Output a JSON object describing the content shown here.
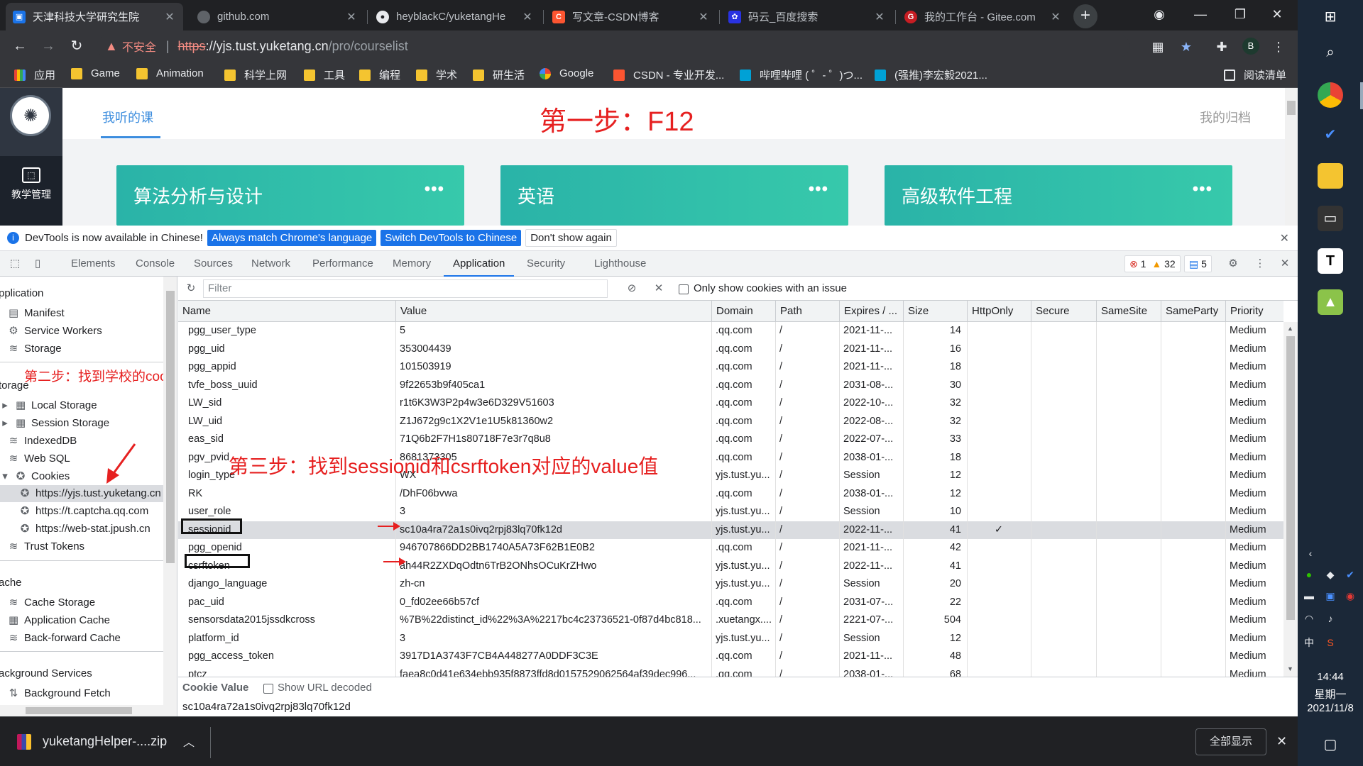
{
  "tabs": [
    {
      "title": "天津科技大学研究生院",
      "active": true
    },
    {
      "title": "github.com"
    },
    {
      "title": "heyblackC/yuketangHe"
    },
    {
      "title": "写文章-CSDN博客"
    },
    {
      "title": "码云_百度搜索"
    },
    {
      "title": "我的工作台 - Gitee.com"
    }
  ],
  "address": {
    "warning": "不安全",
    "scheme": "https",
    "host": "://yjs.tust.yuketang.cn",
    "path": "/pro/courselist"
  },
  "profile_initial": "B",
  "bookmarks": [
    "应用",
    "Game",
    "Animation",
    "科学上网",
    "工具",
    "编程",
    "学术",
    "研生活",
    "Google",
    "CSDN - 专业开发...",
    "哔哩哔哩 ( ゜- ゜)つ...",
    "(强推)李宏毅2021..."
  ],
  "reading_list": "阅读清单",
  "page": {
    "nav_label": "教学管理",
    "tab_label": "我听的课",
    "archive_label": "我的归档",
    "annotation_step1": "第一步：F12",
    "courses": [
      "算法分析与设计",
      "英语",
      "高级软件工程"
    ],
    "more_glyph": "•••"
  },
  "devtools_notice": {
    "text": "DevTools is now available in Chinese!",
    "btn1": "Always match Chrome's language",
    "btn2": "Switch DevTools to Chinese",
    "btn3": "Don't show again"
  },
  "devtools_tabs": [
    "Elements",
    "Console",
    "Sources",
    "Network",
    "Performance",
    "Memory",
    "Application",
    "Security",
    "Lighthouse"
  ],
  "issue_counts": {
    "errors": "1",
    "warnings": "32",
    "messages": "5"
  },
  "sidebar": {
    "section_application": "pplication",
    "manifest": "Manifest",
    "service_workers": "Service Workers",
    "storage_item": "Storage",
    "section_storage": "torage",
    "local_storage": "Local Storage",
    "session_storage": "Session Storage",
    "indexeddb": "IndexedDB",
    "web_sql": "Web SQL",
    "cookies": "Cookies",
    "cookie_origins": [
      "https://yjs.tust.yuketang.cn",
      "https://t.captcha.qq.com",
      "https://web-stat.jpush.cn"
    ],
    "trust_tokens": "Trust Tokens",
    "section_cache": "ache",
    "cache_storage": "Cache Storage",
    "application_cache": "Application Cache",
    "bfcache": "Back-forward Cache",
    "section_bg": "ackground Services",
    "background_fetch": "Background Fetch",
    "annotation_step2": "第二步：找到学校的cookies"
  },
  "cookie_toolbar": {
    "filter_placeholder": "Filter",
    "only_issues": "Only show cookies with an issue"
  },
  "columns": [
    "Name",
    "Value",
    "Domain",
    "Path",
    "Expires / ...",
    "Size",
    "HttpOnly",
    "Secure",
    "SameSite",
    "SameParty",
    "Priority"
  ],
  "cookies": [
    {
      "name": "pgg_user_type",
      "value": "5",
      "domain": ".qq.com",
      "path": "/",
      "expires": "2021-11-...",
      "size": "14",
      "httponly": "",
      "priority": "Medium"
    },
    {
      "name": "pgg_uid",
      "value": "353004439",
      "domain": ".qq.com",
      "path": "/",
      "expires": "2021-11-...",
      "size": "16",
      "httponly": "",
      "priority": "Medium"
    },
    {
      "name": "pgg_appid",
      "value": "101503919",
      "domain": ".qq.com",
      "path": "/",
      "expires": "2021-11-...",
      "size": "18",
      "httponly": "",
      "priority": "Medium"
    },
    {
      "name": "tvfe_boss_uuid",
      "value": "9f22653b9f405ca1",
      "domain": ".qq.com",
      "path": "/",
      "expires": "2031-08-...",
      "size": "30",
      "httponly": "",
      "priority": "Medium"
    },
    {
      "name": "LW_sid",
      "value": "r1t6K3W3P2p4w3e6D329V51603",
      "domain": ".qq.com",
      "path": "/",
      "expires": "2022-10-...",
      "size": "32",
      "httponly": "",
      "priority": "Medium"
    },
    {
      "name": "LW_uid",
      "value": "Z1J672g9c1X2V1e1U5k81360w2",
      "domain": ".qq.com",
      "path": "/",
      "expires": "2022-08-...",
      "size": "32",
      "httponly": "",
      "priority": "Medium"
    },
    {
      "name": "eas_sid",
      "value": "71Q6b2F7H1s80718F7e3r7q8u8",
      "domain": ".qq.com",
      "path": "/",
      "expires": "2022-07-...",
      "size": "33",
      "httponly": "",
      "priority": "Medium"
    },
    {
      "name": "pgv_pvid",
      "value": "8681373305",
      "domain": ".qq.com",
      "path": "/",
      "expires": "2038-01-...",
      "size": "18",
      "httponly": "",
      "priority": "Medium"
    },
    {
      "name": "login_type",
      "value": "WX",
      "domain": "yjs.tust.yu...",
      "path": "/",
      "expires": "Session",
      "size": "12",
      "httponly": "",
      "priority": "Medium"
    },
    {
      "name": "RK",
      "value": "/DhF06bvwa",
      "domain": ".qq.com",
      "path": "/",
      "expires": "2038-01-...",
      "size": "12",
      "httponly": "",
      "priority": "Medium"
    },
    {
      "name": "user_role",
      "value": "3",
      "domain": "yjs.tust.yu...",
      "path": "/",
      "expires": "Session",
      "size": "10",
      "httponly": "",
      "priority": "Medium"
    },
    {
      "name": "sessionid",
      "value": "sc10a4ra72a1s0ivq2rpj83lq70fk12d",
      "domain": "yjs.tust.yu...",
      "path": "/",
      "expires": "2022-11-...",
      "size": "41",
      "httponly": "✓",
      "priority": "Medium"
    },
    {
      "name": "pgg_openid",
      "value": "946707866DD2BB1740A5A73F62B1E0B2",
      "domain": ".qq.com",
      "path": "/",
      "expires": "2021-11-...",
      "size": "42",
      "httponly": "",
      "priority": "Medium"
    },
    {
      "name": "csrftoken",
      "value": "ah44R2ZXDqOdtn6TrB2ONhsOCuKrZHwo",
      "domain": "yjs.tust.yu...",
      "path": "/",
      "expires": "2022-11-...",
      "size": "41",
      "httponly": "",
      "priority": "Medium"
    },
    {
      "name": "django_language",
      "value": "zh-cn",
      "domain": "yjs.tust.yu...",
      "path": "/",
      "expires": "Session",
      "size": "20",
      "httponly": "",
      "priority": "Medium"
    },
    {
      "name": "pac_uid",
      "value": "0_fd02ee66b57cf",
      "domain": ".qq.com",
      "path": "/",
      "expires": "2031-07-...",
      "size": "22",
      "httponly": "",
      "priority": "Medium"
    },
    {
      "name": "sensorsdata2015jssdkcross",
      "value": "%7B%22distinct_id%22%3A%2217bc4c23736521-0f87d4bc818...",
      "domain": ".xuetangx....",
      "path": "/",
      "expires": "2221-07-...",
      "size": "504",
      "httponly": "",
      "priority": "Medium"
    },
    {
      "name": "platform_id",
      "value": "3",
      "domain": "yjs.tust.yu...",
      "path": "/",
      "expires": "Session",
      "size": "12",
      "httponly": "",
      "priority": "Medium"
    },
    {
      "name": "pgg_access_token",
      "value": "3917D1A3743F7CB4A448277A0DDF3C3E",
      "domain": ".qq.com",
      "path": "/",
      "expires": "2021-11-...",
      "size": "48",
      "httponly": "",
      "priority": "Medium"
    },
    {
      "name": "ptcz",
      "value": "faea8c0d41e634ebb935f8873ffd8d0157529062564af39dec996...",
      "domain": ".qq.com",
      "path": "/",
      "expires": "2038-01-...",
      "size": "68",
      "httponly": "",
      "priority": "Medium"
    }
  ],
  "annotation_step3": "第三步：找到sessionid和csrftoken对应的value值",
  "cookie_value": {
    "title": "Cookie Value",
    "show_decoded": "Show URL decoded",
    "value": "sc10a4ra72a1s0ivq2rpj83lq70fk12d"
  },
  "download": {
    "filename": "yuketangHelper-....zip",
    "show_all": "全部显示"
  },
  "taskbar": {
    "time": "14:44",
    "weekday": "星期一",
    "date": "2021/11/8",
    "ime": "中"
  },
  "colors": {
    "annotation_red": "#e62020",
    "course_teal": "#2ab3a8",
    "devtools_blue": "#1a73e8",
    "chrome_dark": "#202124"
  }
}
